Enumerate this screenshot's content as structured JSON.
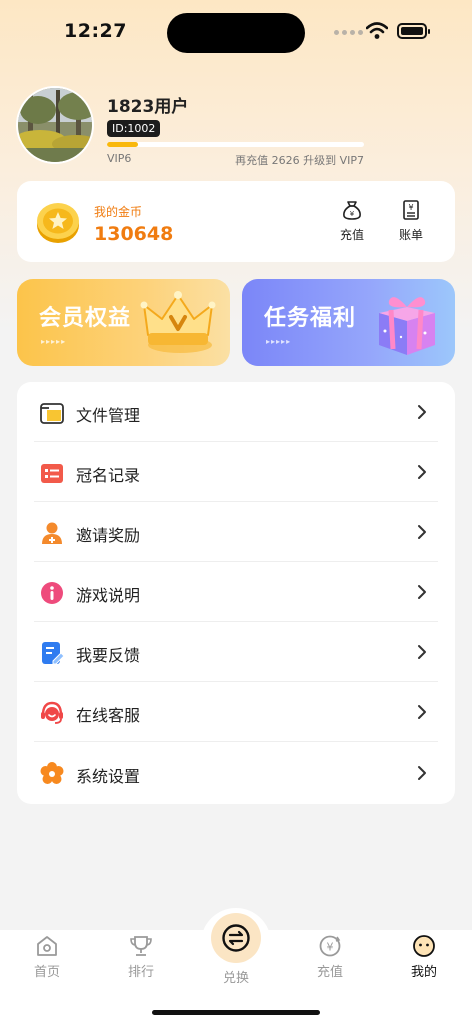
{
  "status_bar": {
    "time": "12:27"
  },
  "profile": {
    "username": "1823用户",
    "user_id": "ID:1002",
    "vip_level": "VIP6",
    "vip_next_text": "再充值 2626 升级到 VIP7",
    "vip_progress_fraction": 0.12
  },
  "coins": {
    "label": "我的金币",
    "value": "130648",
    "recharge_label": "充值",
    "bill_label": "账单"
  },
  "banners": {
    "vip": {
      "title": "会员权益",
      "arrows": "▸▸▸▸▸"
    },
    "task": {
      "title": "任务福利",
      "arrows": "▸▸▸▸▸"
    }
  },
  "menu": {
    "items": [
      {
        "label": "文件管理",
        "icon": "folder-icon"
      },
      {
        "label": "冠名记录",
        "icon": "list-icon"
      },
      {
        "label": "邀请奖励",
        "icon": "invite-user-icon"
      },
      {
        "label": "游戏说明",
        "icon": "info-icon"
      },
      {
        "label": "我要反馈",
        "icon": "feedback-edit-icon"
      },
      {
        "label": "在线客服",
        "icon": "headset-icon"
      },
      {
        "label": "系统设置",
        "icon": "settings-flower-icon"
      }
    ]
  },
  "tabbar": {
    "home": "首页",
    "rank": "排行",
    "exchange": "兑换",
    "recharge": "充值",
    "mine": "我的"
  },
  "colors": {
    "accent_orange": "#f07c10",
    "vip_banner": "#fcc44a",
    "task_banner": "#7b86f8",
    "progress_fill": "#f9b80c"
  }
}
